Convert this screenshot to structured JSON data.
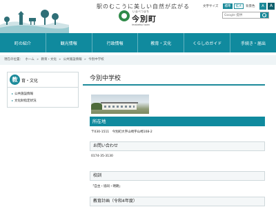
{
  "header": {
    "tagline": "駅のむこうに美しい自然が広がる",
    "logo": {
      "ruby": "いまべつまち",
      "name": "今別町",
      "roman": "imabetsu town"
    },
    "tools": {
      "font_size_label": "文字サイズ",
      "std_label": "標準",
      "large_label": "拡大",
      "color_label": "背景色",
      "size_a_small": "A",
      "size_a_large": "A"
    },
    "search": {
      "placeholder": "Google 提供"
    }
  },
  "gnav": {
    "items": [
      {
        "label": "町の紹介"
      },
      {
        "label": "観光情報"
      },
      {
        "label": "行政情報"
      },
      {
        "label": "教育・文化"
      },
      {
        "label": "くらしのガイド"
      },
      {
        "label": "手続き・届出"
      }
    ]
  },
  "breadcrumb": {
    "items": [
      "現在の位置：",
      "ホーム",
      "»",
      "教育・文化",
      "»",
      "公共施設情報",
      "»",
      "今別中学校"
    ]
  },
  "sidebar": {
    "circle": "教",
    "title": "育・文化",
    "links": [
      "公共施設情報",
      "文化財指定状況"
    ]
  },
  "main": {
    "title": "今別中学校",
    "sections": {
      "location": {
        "heading": "所在地",
        "text": "〒030-1511　今別町大字山崎字山崎108-2"
      },
      "contact": {
        "heading": "お問い合わせ",
        "text": "0174-35-3130"
      },
      "motto": {
        "heading": "校訓",
        "text": "「自主・協同・明朗」"
      },
      "plan": {
        "heading": "教育計画（令和4年度）"
      }
    }
  },
  "colors": {
    "accent": "#108a9e",
    "accent_dark": "#0d5f6c",
    "logo_green": "#2f8a49"
  }
}
